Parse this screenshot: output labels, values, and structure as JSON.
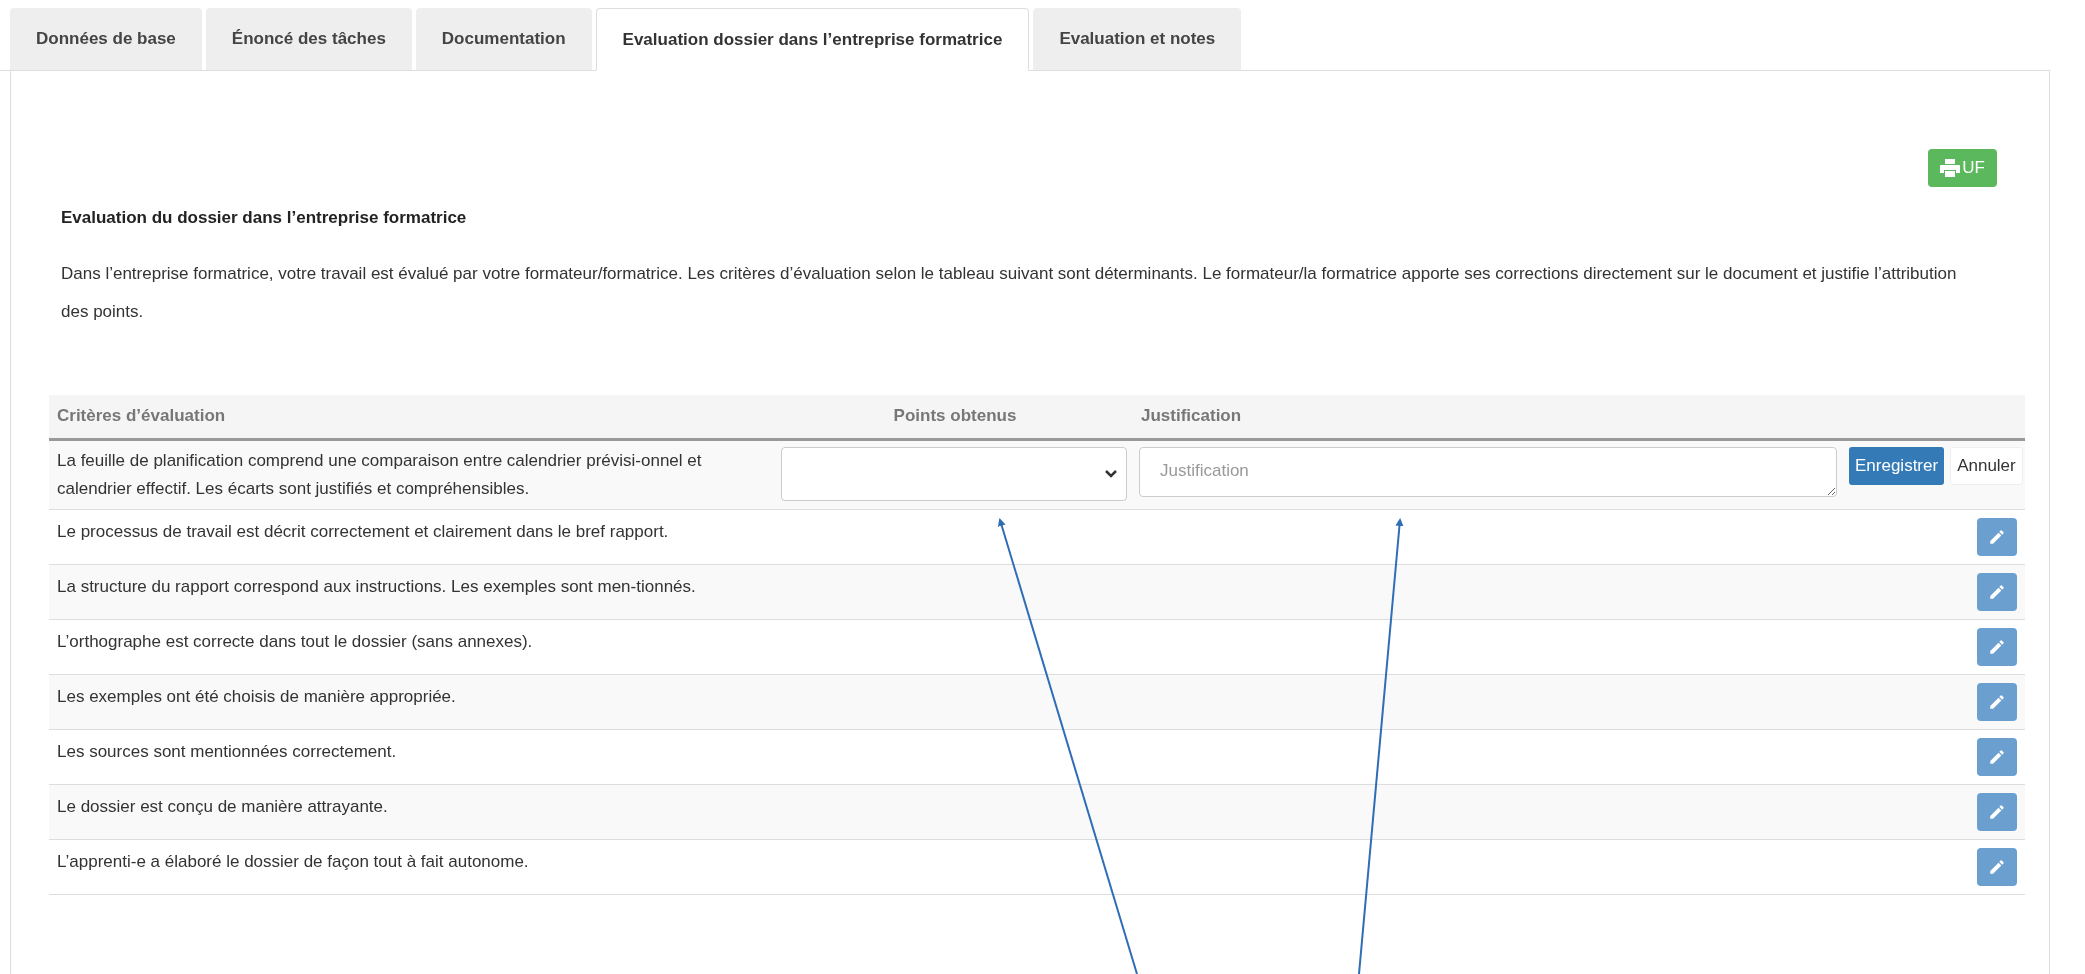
{
  "tabs": [
    {
      "label": "Données de base",
      "selected": false
    },
    {
      "label": "Énoncé des tâches",
      "selected": false
    },
    {
      "label": "Documentation",
      "selected": false
    },
    {
      "label": "Evaluation dossier dans l’entreprise formatrice",
      "selected": true
    },
    {
      "label": "Evaluation et notes",
      "selected": false
    }
  ],
  "print_button": {
    "label": "UF"
  },
  "section": {
    "title": "Evaluation du dossier dans l’entreprise formatrice",
    "text": "Dans l’entreprise formatrice, votre travail est évalué par votre formateur/formatrice. Les critères d’évaluation selon le tableau suivant sont déterminants. Le formateur/la formatrice apporte ses corrections directement sur le document et justifie l’attribution des points."
  },
  "table": {
    "columns": [
      "Critères d’évaluation",
      "Points obtenus",
      "Justification"
    ],
    "rows": [
      {
        "criterion": "La feuille de planification comprend une comparaison entre calendrier prévisi-onnel et calendrier effectif. Les écarts sont justifiés et compréhensibles.",
        "editing": true,
        "justification_placeholder": "Justification",
        "save_label": "Enregistrer",
        "cancel_label": "Annuler"
      },
      {
        "criterion": "Le processus de travail est décrit correctement et clairement dans le bref rapport.",
        "editing": false
      },
      {
        "criterion": "La structure du rapport correspond aux instructions. Les exemples sont men-tionnés.",
        "editing": false
      },
      {
        "criterion": "L’orthographe est correcte dans tout le dossier (sans annexes).",
        "editing": false
      },
      {
        "criterion": "Les exemples ont été choisis de manière appropriée.",
        "editing": false
      },
      {
        "criterion": "Les sources sont mentionnées correctement.",
        "editing": false
      },
      {
        "criterion": "Le dossier est conçu de manière attrayante.",
        "editing": false
      },
      {
        "criterion": "L’apprenti-e a élaboré le dossier de façon tout à fait autonome.",
        "editing": false
      }
    ]
  }
}
